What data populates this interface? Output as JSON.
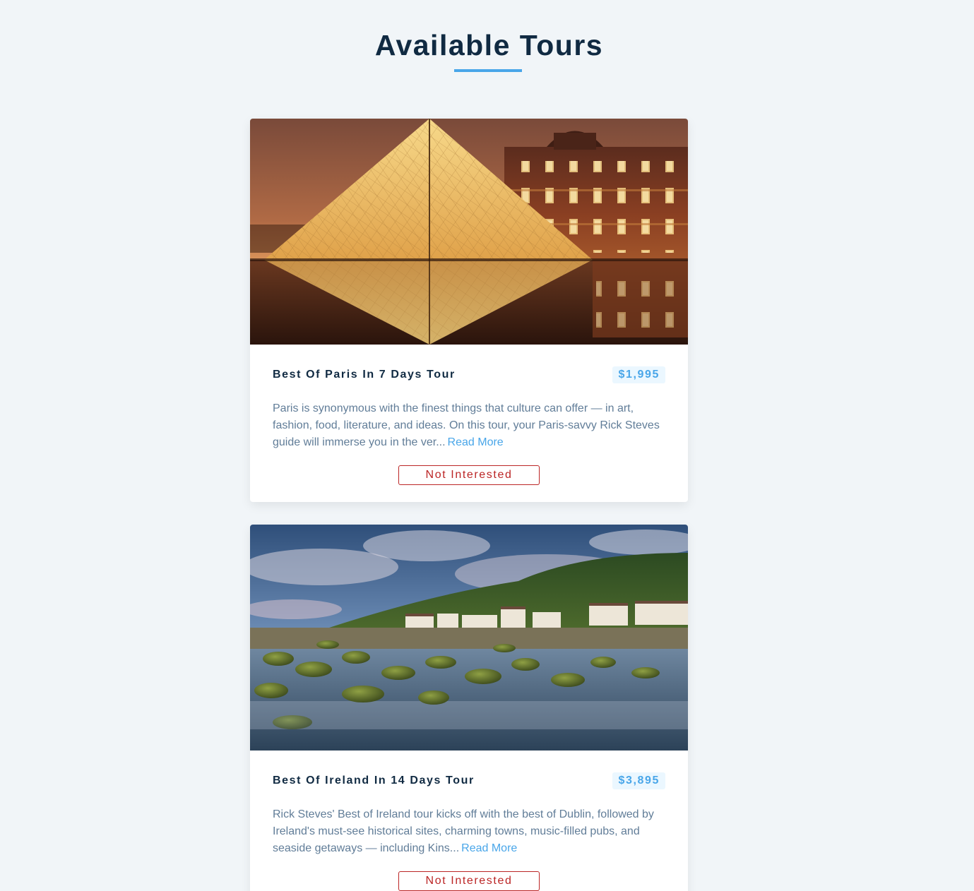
{
  "page": {
    "title": "Available Tours"
  },
  "colors": {
    "background": "#f1f5f8",
    "title": "#102a42",
    "accent": "#49a6e9",
    "price_bg": "#ebf7ff",
    "body_text": "#617d98",
    "danger": "#bb2525"
  },
  "tours": [
    {
      "name": "Best Of Paris In 7 Days Tour",
      "price": "$1,995",
      "image_subject": "louvre-pyramid-at-night",
      "description": "Paris is synonymous with the finest things that culture can offer — in art, fashion, food, literature, and ideas. On this tour, your Paris-savvy Rick Steves guide will immerse you in the ver...",
      "read_more_label": "Read More",
      "not_interested_label": "Not Interested"
    },
    {
      "name": "Best Of Ireland In 14 Days Tour",
      "price": "$3,895",
      "image_subject": "irish-coastal-village-with-mossy-rocks",
      "description": "Rick Steves' Best of Ireland tour kicks off with the best of Dublin, followed by Ireland's must-see historical sites, charming towns, music-filled pubs, and seaside getaways — including Kins...",
      "read_more_label": "Read More",
      "not_interested_label": "Not Interested"
    }
  ]
}
